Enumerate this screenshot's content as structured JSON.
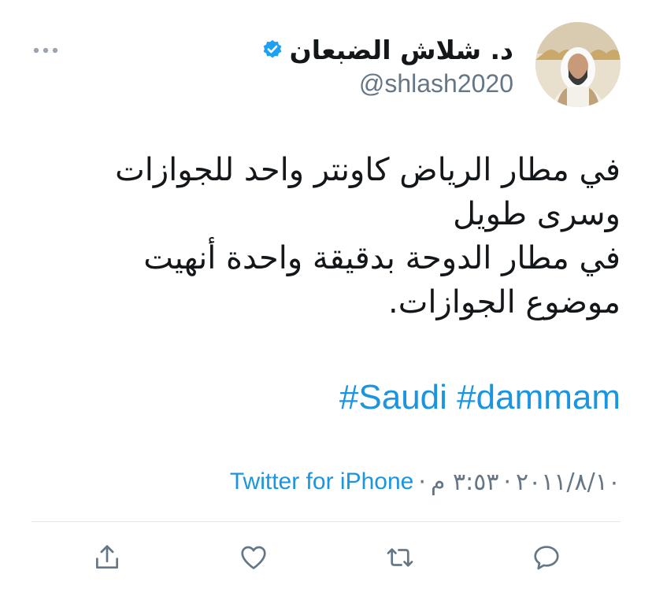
{
  "user": {
    "display_name": "د. شلاش الضبعان",
    "handle": "@shlash2020",
    "verified": true
  },
  "tweet": {
    "lines": [
      "في مطار الرياض كاونتر واحد للجوازات",
      "وسرى طويل",
      "في مطار الدوحة بدقيقة واحدة أنهيت",
      "موضوع الجوازات."
    ],
    "hashtags": [
      "#Saudi",
      "#dammam"
    ]
  },
  "meta": {
    "date": "٢٠١١/٨/١٠",
    "time": "٣:٥٣ م",
    "separator": "·",
    "source": "Twitter for iPhone"
  },
  "colors": {
    "link": "#1b95e0",
    "secondary_text": "#657786",
    "primary_text": "#14171a",
    "divider": "#e1e8ed",
    "verified_badge": "#1da1f2"
  },
  "icons": {
    "more": "more-horizontal-icon",
    "verified": "verified-badge-icon",
    "reply": "reply-icon",
    "retweet": "retweet-icon",
    "like": "heart-icon",
    "share": "share-icon"
  }
}
